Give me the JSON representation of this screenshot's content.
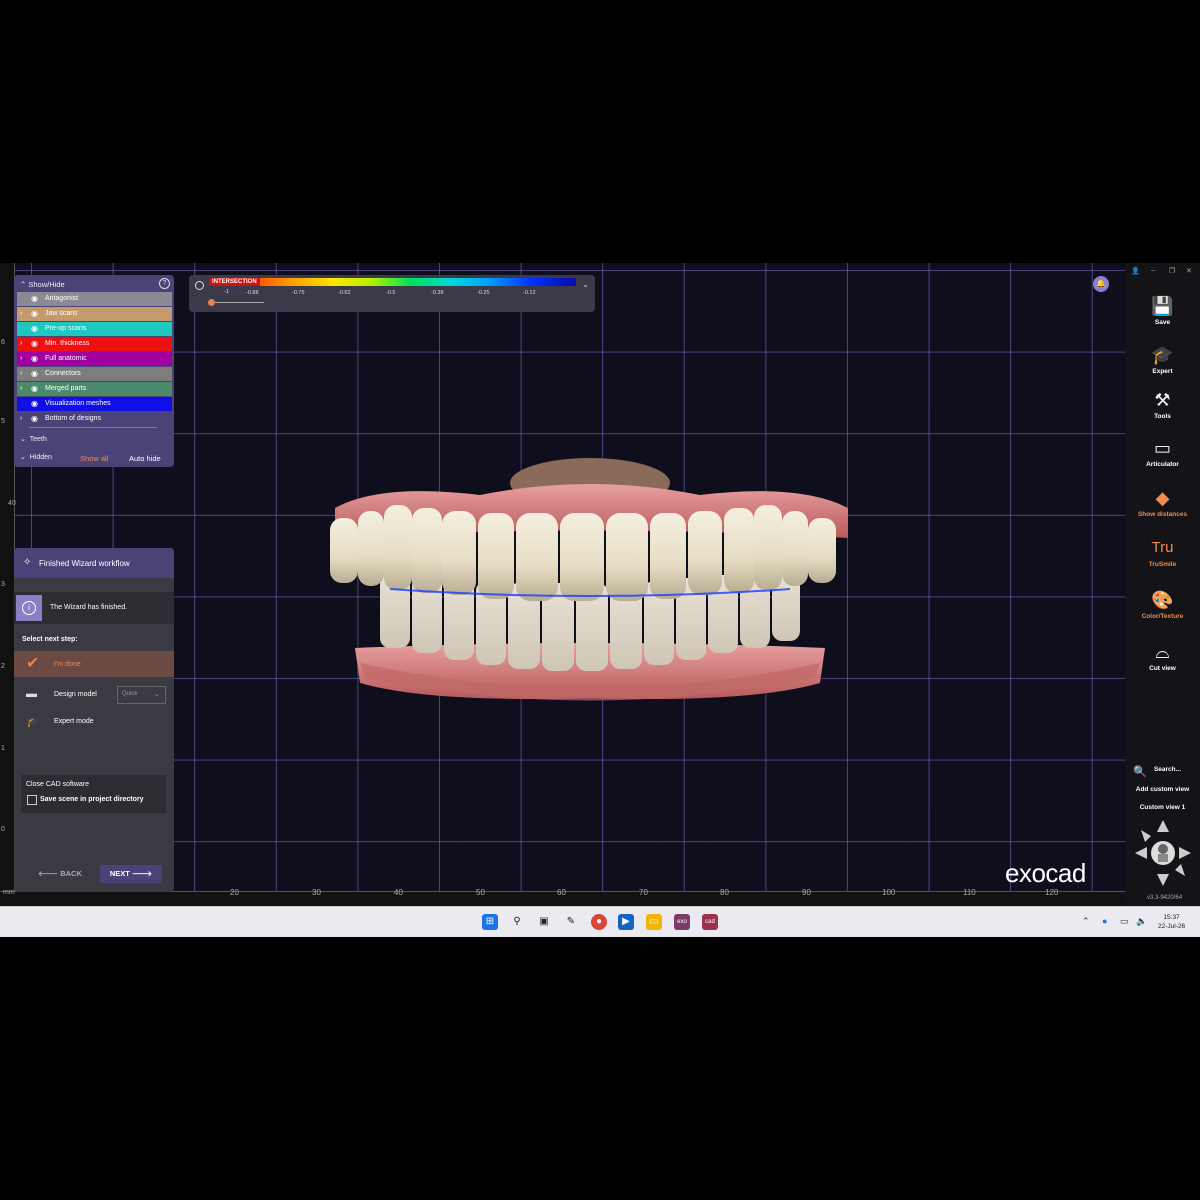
{
  "show_hide": {
    "title": "Show/Hide",
    "rows": [
      {
        "label": "Antagonist",
        "color": "#8a8a94",
        "arrow": false
      },
      {
        "label": "Jaw scans",
        "color": "#c49a6c",
        "arrow": true
      },
      {
        "label": "Pre-op scans",
        "color": "#1ec8c0",
        "arrow": false
      },
      {
        "label": "Min. thickness",
        "color": "#ee1111",
        "arrow": true
      },
      {
        "label": "Full anatomic",
        "color": "#a000a0",
        "arrow": true
      },
      {
        "label": "Connectors",
        "color": "#7d7d7d",
        "arrow": true
      },
      {
        "label": "Merged parts",
        "color": "#4a8a6a",
        "arrow": true
      },
      {
        "label": "Visualization meshes",
        "color": "#1010e6",
        "arrow": false
      },
      {
        "label": "Bottom of designs",
        "color": "transparent",
        "arrow": true
      }
    ],
    "teeth": "Teeth",
    "hidden": "Hidden",
    "show_all": "Show all",
    "auto_hide": "Auto hide"
  },
  "intersection": {
    "title": "INTERSECTION",
    "ticks": [
      "-1",
      "-0.88",
      "-0.75",
      "-0.62",
      "-0.5",
      "-0.38",
      "-0.25",
      "-0.12"
    ]
  },
  "wizard": {
    "title": "Finished Wizard workflow",
    "info": "The Wizard has finished.",
    "select_next": "Select next step:",
    "done": "I'm done",
    "design_model": "Design model",
    "design_model_option": "Quick",
    "expert_mode": "Expert mode",
    "close_cad": "Close CAD software",
    "save_scene": "Save scene in project directory",
    "back": "BACK",
    "next": "NEXT"
  },
  "toolbar": {
    "save": "Save",
    "expert": "Expert",
    "tools": "Tools",
    "articulator": "Articulator",
    "show_distances": "Show distances",
    "trusmile": "TruSmile",
    "trusmile_logo": "Tru",
    "color_texture": "Color/Texture",
    "cut_view": "Cut view",
    "search": "Search...",
    "add_custom_view": "Add custom view",
    "custom_view_1": "Custom view 1",
    "version": "v3.3-9420/64"
  },
  "brand": "exocad",
  "ruler": {
    "unit": "mm",
    "bottom": [
      "20",
      "30",
      "40",
      "50",
      "60",
      "70",
      "80",
      "90",
      "100",
      "110",
      "120"
    ],
    "left": [
      "6",
      "5",
      "40",
      "3",
      "2",
      "1",
      "0"
    ]
  },
  "taskbar": {
    "time": "15:37",
    "date": "22-Jul-26",
    "apps": [
      "windows-start",
      "search",
      "task-view",
      "snipping",
      "chrome",
      "remote",
      "explorer",
      "exo",
      "cad"
    ]
  }
}
